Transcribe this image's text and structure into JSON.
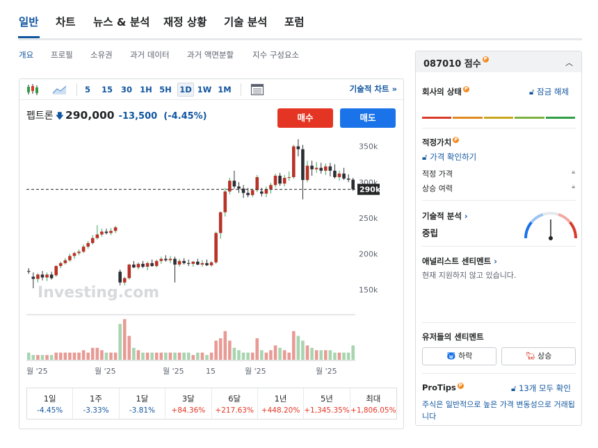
{
  "main_tabs": [
    "일반",
    "차트",
    "뉴스 & 분석",
    "재정 상황",
    "기술 분석",
    "포럼"
  ],
  "sub_nav": [
    "개요",
    "프로필",
    "소유권",
    "과거 데이터",
    "과거 액면분할",
    "지수 구성요소"
  ],
  "toolbar": {
    "intervals": [
      "5",
      "15",
      "30",
      "1H",
      "5H",
      "1D",
      "1W",
      "1M"
    ],
    "active_interval": "1D",
    "tech_chart_link": "기술적 차트 »"
  },
  "quote": {
    "name": "펩트론",
    "price": "290,000",
    "change": "-13,500",
    "change_pct": "(-4.45%)",
    "buy_label": "매수",
    "sell_label": "매도"
  },
  "watermark": "Investing.com",
  "chart_data": {
    "type": "candlestick",
    "title": "",
    "y_ticks": [
      "350k",
      "300k",
      "250k",
      "200k",
      "150k"
    ],
    "ylim": [
      118000,
      372000
    ],
    "current_price_label": "290k",
    "current_price": 290000,
    "x_tick_labels": [
      "월 '25",
      "월 '25",
      "월 '25",
      "15",
      "월 '25",
      "월 '25"
    ],
    "candles": [
      {
        "o": 176000,
        "h": 180000,
        "l": 172000,
        "c": 175000
      },
      {
        "o": 168000,
        "h": 174000,
        "l": 152000,
        "c": 165000
      },
      {
        "o": 165000,
        "h": 173000,
        "l": 160000,
        "c": 171000
      },
      {
        "o": 171000,
        "h": 176000,
        "l": 163000,
        "c": 167000
      },
      {
        "o": 167000,
        "h": 174000,
        "l": 162000,
        "c": 171000
      },
      {
        "o": 171000,
        "h": 175000,
        "l": 164000,
        "c": 166000
      },
      {
        "o": 170000,
        "h": 184000,
        "l": 168000,
        "c": 183000
      },
      {
        "o": 183000,
        "h": 189000,
        "l": 180000,
        "c": 187000
      },
      {
        "o": 187000,
        "h": 194000,
        "l": 185000,
        "c": 191000
      },
      {
        "o": 191000,
        "h": 200000,
        "l": 189000,
        "c": 197000
      },
      {
        "o": 197000,
        "h": 203000,
        "l": 193000,
        "c": 201000
      },
      {
        "o": 201000,
        "h": 206000,
        "l": 198000,
        "c": 203000
      },
      {
        "o": 203000,
        "h": 213000,
        "l": 201000,
        "c": 210000
      },
      {
        "o": 210000,
        "h": 218000,
        "l": 207000,
        "c": 215000
      },
      {
        "o": 215000,
        "h": 226000,
        "l": 213000,
        "c": 222000
      },
      {
        "o": 222000,
        "h": 240000,
        "l": 220000,
        "c": 227000
      },
      {
        "o": 227000,
        "h": 235000,
        "l": 224000,
        "c": 231000
      },
      {
        "o": 231000,
        "h": 235000,
        "l": 227000,
        "c": 229000
      },
      {
        "o": 229000,
        "h": 236000,
        "l": 226000,
        "c": 232000
      },
      {
        "o": 232000,
        "h": 239000,
        "l": 229000,
        "c": 237000
      },
      {
        "o": 175000,
        "h": 178000,
        "l": 156000,
        "c": 160000
      },
      {
        "o": 160000,
        "h": 168000,
        "l": 156000,
        "c": 166000
      },
      {
        "o": 166000,
        "h": 186000,
        "l": 164000,
        "c": 185000
      },
      {
        "o": 185000,
        "h": 190000,
        "l": 180000,
        "c": 181000
      },
      {
        "o": 181000,
        "h": 188000,
        "l": 178000,
        "c": 186000
      },
      {
        "o": 186000,
        "h": 190000,
        "l": 180000,
        "c": 182000
      },
      {
        "o": 182000,
        "h": 189000,
        "l": 177000,
        "c": 187000
      },
      {
        "o": 187000,
        "h": 192000,
        "l": 182000,
        "c": 183000
      },
      {
        "o": 183000,
        "h": 192000,
        "l": 181000,
        "c": 190000
      },
      {
        "o": 190000,
        "h": 196000,
        "l": 186000,
        "c": 193000
      },
      {
        "o": 193000,
        "h": 198000,
        "l": 189000,
        "c": 191000
      },
      {
        "o": 191000,
        "h": 197000,
        "l": 187000,
        "c": 193000
      },
      {
        "o": 193000,
        "h": 196000,
        "l": 160000,
        "c": 185000
      },
      {
        "o": 185000,
        "h": 193000,
        "l": 182000,
        "c": 190000
      },
      {
        "o": 190000,
        "h": 194000,
        "l": 185000,
        "c": 187000
      },
      {
        "o": 187000,
        "h": 192000,
        "l": 183000,
        "c": 186000
      },
      {
        "o": 186000,
        "h": 190000,
        "l": 182000,
        "c": 189000
      },
      {
        "o": 189000,
        "h": 193000,
        "l": 184000,
        "c": 185000
      },
      {
        "o": 185000,
        "h": 191000,
        "l": 182000,
        "c": 187000
      },
      {
        "o": 187000,
        "h": 192000,
        "l": 183000,
        "c": 184000
      },
      {
        "o": 184000,
        "h": 190000,
        "l": 182000,
        "c": 188000
      },
      {
        "o": 188000,
        "h": 231000,
        "l": 186000,
        "c": 229000
      },
      {
        "o": 229000,
        "h": 259000,
        "l": 221000,
        "c": 258000
      },
      {
        "o": 258000,
        "h": 292000,
        "l": 252000,
        "c": 287000
      },
      {
        "o": 287000,
        "h": 306000,
        "l": 283000,
        "c": 302000
      },
      {
        "o": 302000,
        "h": 316000,
        "l": 291000,
        "c": 294000
      },
      {
        "o": 294000,
        "h": 300000,
        "l": 285000,
        "c": 291000
      },
      {
        "o": 291000,
        "h": 296000,
        "l": 278000,
        "c": 285000
      },
      {
        "o": 285000,
        "h": 292000,
        "l": 279000,
        "c": 282000
      },
      {
        "o": 282000,
        "h": 291000,
        "l": 279000,
        "c": 289000
      },
      {
        "o": 289000,
        "h": 310000,
        "l": 286000,
        "c": 307000
      },
      {
        "o": 287000,
        "h": 292000,
        "l": 280000,
        "c": 284000
      },
      {
        "o": 284000,
        "h": 294000,
        "l": 279000,
        "c": 290000
      },
      {
        "o": 290000,
        "h": 299000,
        "l": 284000,
        "c": 296000
      },
      {
        "o": 296000,
        "h": 312000,
        "l": 293000,
        "c": 309000
      },
      {
        "o": 309000,
        "h": 313000,
        "l": 295000,
        "c": 298000
      },
      {
        "o": 298000,
        "h": 310000,
        "l": 294000,
        "c": 306000
      },
      {
        "o": 306000,
        "h": 315000,
        "l": 302000,
        "c": 307000
      },
      {
        "o": 307000,
        "h": 352000,
        "l": 305000,
        "c": 350000
      },
      {
        "o": 350000,
        "h": 360000,
        "l": 336000,
        "c": 346000
      },
      {
        "o": 346000,
        "h": 352000,
        "l": 276000,
        "c": 303000
      },
      {
        "o": 303000,
        "h": 330000,
        "l": 300000,
        "c": 323000
      },
      {
        "o": 323000,
        "h": 330000,
        "l": 309000,
        "c": 318000
      },
      {
        "o": 318000,
        "h": 328000,
        "l": 313000,
        "c": 320000
      },
      {
        "o": 320000,
        "h": 327000,
        "l": 312000,
        "c": 316000
      },
      {
        "o": 316000,
        "h": 326000,
        "l": 310000,
        "c": 322000
      },
      {
        "o": 322000,
        "h": 327000,
        "l": 308000,
        "c": 316000
      },
      {
        "o": 316000,
        "h": 325000,
        "l": 305000,
        "c": 307000
      },
      {
        "o": 307000,
        "h": 316000,
        "l": 302000,
        "c": 312000
      },
      {
        "o": 312000,
        "h": 320000,
        "l": 303000,
        "c": 305000
      },
      {
        "o": 305000,
        "h": 311000,
        "l": 300000,
        "c": 303500
      },
      {
        "o": 303500,
        "h": 306000,
        "l": 288000,
        "c": 290000
      }
    ],
    "volumes": [
      3,
      2,
      2,
      2,
      2,
      2,
      3,
      3,
      3,
      3,
      3,
      3,
      4,
      3,
      5,
      5,
      4,
      3,
      3,
      3,
      15,
      17,
      10,
      5,
      4,
      3,
      3,
      3,
      3,
      3,
      3,
      3,
      3,
      3,
      3,
      3,
      2,
      3,
      3,
      2,
      3,
      8,
      9,
      12,
      8,
      5,
      4,
      3,
      3,
      3,
      9,
      4,
      3,
      4,
      6,
      5,
      4,
      3,
      12,
      10,
      8,
      6,
      5,
      4,
      4,
      4,
      4,
      3,
      3,
      3,
      3,
      6
    ],
    "volume_max": 18
  },
  "periods": [
    {
      "label": "1일",
      "value": "-4.45%",
      "dir": "neg"
    },
    {
      "label": "1주",
      "value": "-3.33%",
      "dir": "neg"
    },
    {
      "label": "1달",
      "value": "-3.81%",
      "dir": "neg"
    },
    {
      "label": "3달",
      "value": "+84.36%",
      "dir": "pos"
    },
    {
      "label": "6달",
      "value": "+217.63%",
      "dir": "pos"
    },
    {
      "label": "1년",
      "value": "+448.20%",
      "dir": "pos"
    },
    {
      "label": "5년",
      "value": "+1,345.35%",
      "dir": "pos"
    },
    {
      "label": "최대",
      "value": "+1,806.05%",
      "dir": "pos"
    }
  ],
  "score": {
    "title": "087010 점수",
    "pro_badge": "P",
    "company_status": "회사의 상태",
    "unlock": "잠금 해제",
    "status_bar_colors": [
      "#d83a2a",
      "#e08a1e",
      "#c9a51e",
      "#7bb13c",
      "#2f9e44"
    ],
    "fair_value_title": "적정가치",
    "check_price": "가격 확인하기",
    "fair_price_label": "적정 가격",
    "upside_label": "상승 여력",
    "tech_title": "기술적 분석",
    "tech_value": "중립",
    "gauge_level": 0.5,
    "analyst_title": "애널리스트 센티멘트",
    "analyst_unsupported": "현재 지원하지 않고 있습니다.",
    "user_title": "유저들의 센티멘트",
    "bear_label": "하락",
    "bull_label": "상승",
    "protips_title": "ProTips",
    "protips_link": "13개 모두 확인",
    "protips_text": "주식은 일반적으로 높은 가격 변동성으로 거래됩니다"
  }
}
